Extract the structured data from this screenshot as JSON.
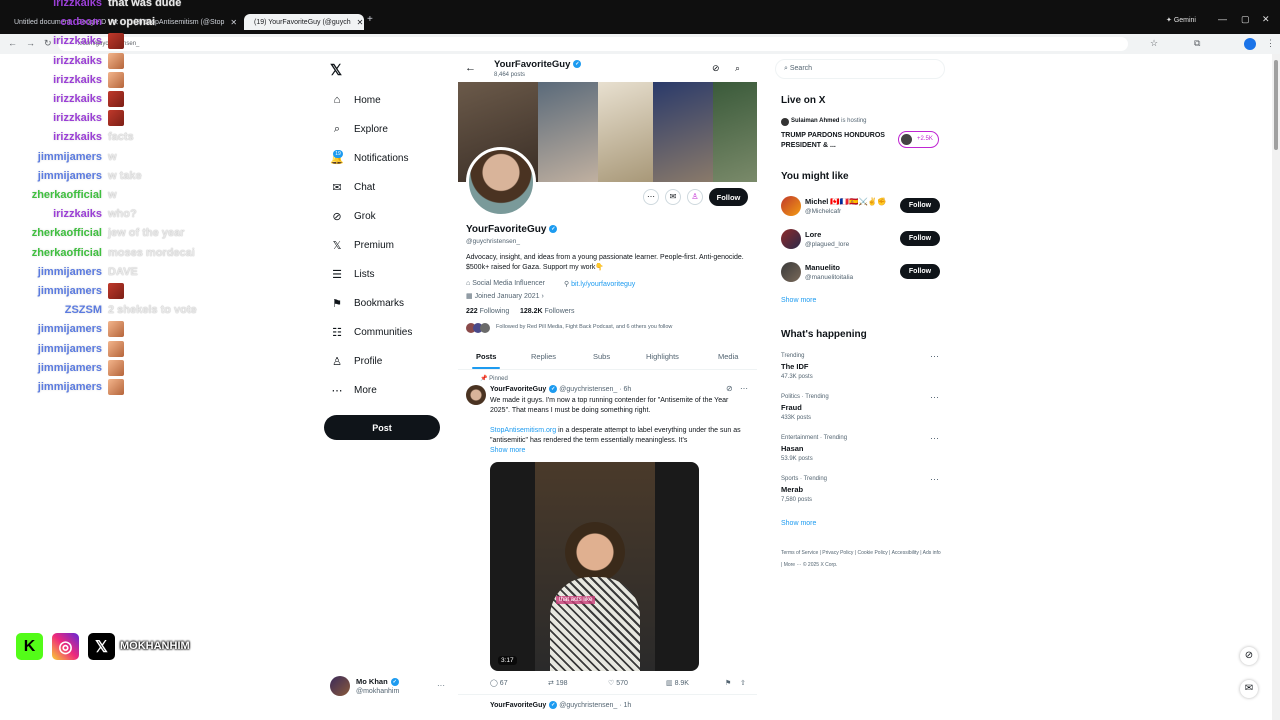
{
  "browser": {
    "tabs": [
      {
        "label": "Untitled document - Google D",
        "active": false
      },
      {
        "label": "(8) StopAntisemitism (@Stop",
        "active": false
      },
      {
        "label": "(19) YourFavoriteGuy (@guych",
        "active": true
      }
    ],
    "new_tab": "+",
    "gemini_label": "Gemini",
    "url": "x.com/guychristensen_"
  },
  "chat": [
    {
      "user": "irizzkaiks",
      "msg": "that was dude",
      "color": "#9b3fd6",
      "emote": ""
    },
    {
      "user": "cadeom",
      "msg": "w openai",
      "color": "#9b3fd6",
      "emote": ""
    },
    {
      "user": "irizzkaiks",
      "msg": "",
      "color": "#9b3fd6",
      "emote": "red"
    },
    {
      "user": "irizzkaiks",
      "msg": "",
      "color": "#9b3fd6",
      "emote": "face"
    },
    {
      "user": "irizzkaiks",
      "msg": "",
      "color": "#9b3fd6",
      "emote": "face"
    },
    {
      "user": "irizzkaiks",
      "msg": "",
      "color": "#9b3fd6",
      "emote": "red"
    },
    {
      "user": "irizzkaiks",
      "msg": "",
      "color": "#9b3fd6",
      "emote": "red"
    },
    {
      "user": "irizzkaiks",
      "msg": "facts",
      "color": "#9b3fd6",
      "emote": ""
    },
    {
      "user": "jimmijamers",
      "msg": "w",
      "color": "#5b7be0",
      "emote": ""
    },
    {
      "user": "jimmijamers",
      "msg": "w take",
      "color": "#5b7be0",
      "emote": ""
    },
    {
      "user": "zherkaofficial",
      "msg": "w",
      "color": "#3fbf3f",
      "emote": ""
    },
    {
      "user": "irizzkaiks",
      "msg": "who?",
      "color": "#9b3fd6",
      "emote": ""
    },
    {
      "user": "zherkaofficial",
      "msg": "jew of the year",
      "color": "#3fbf3f",
      "emote": ""
    },
    {
      "user": "zherkaofficial",
      "msg": "moses mordecai",
      "color": "#3fbf3f",
      "emote": ""
    },
    {
      "user": "jimmijamers",
      "msg": "DAVE",
      "color": "#5b7be0",
      "emote": ""
    },
    {
      "user": "jimmijamers",
      "msg": "",
      "color": "#5b7be0",
      "emote": "red"
    },
    {
      "user": "ZSZSM",
      "msg": "2 shekels to vote",
      "color": "#5b7be0",
      "emote": ""
    },
    {
      "user": "jimmijamers",
      "msg": "",
      "color": "#5b7be0",
      "emote": "face"
    },
    {
      "user": "jimmijamers",
      "msg": "",
      "color": "#5b7be0",
      "emote": "face"
    },
    {
      "user": "jimmijamers",
      "msg": "",
      "color": "#5b7be0",
      "emote": "face"
    },
    {
      "user": "jimmijamers",
      "msg": "",
      "color": "#5b7be0",
      "emote": "face"
    }
  ],
  "socials": {
    "kick": "K",
    "instagram": "◎",
    "x": "𝕏",
    "handle": "MOKHANHIM"
  },
  "nav": {
    "logo": "𝕏",
    "items": [
      {
        "label": "Home",
        "icon": "⌂"
      },
      {
        "label": "Explore",
        "icon": "⌕"
      },
      {
        "label": "Notifications",
        "icon": "🔔"
      },
      {
        "label": "Chat",
        "icon": "✉"
      },
      {
        "label": "Grok",
        "icon": "⊘"
      },
      {
        "label": "Premium",
        "icon": "𝕏"
      },
      {
        "label": "Lists",
        "icon": "☰"
      },
      {
        "label": "Bookmarks",
        "icon": "⚑"
      },
      {
        "label": "Communities",
        "icon": "☷"
      },
      {
        "label": "Profile",
        "icon": "♙"
      },
      {
        "label": "More",
        "icon": "⋯"
      }
    ],
    "notif_badge": "19",
    "post_label": "Post",
    "account": {
      "name": "Mo Khan",
      "handle": "@mokhanhim",
      "more": "···"
    }
  },
  "profile": {
    "header_name": "YourFavoriteGuy",
    "header_posts": "8,464 posts",
    "name": "YourFavoriteGuy",
    "handle": "@guychristensen_",
    "bio": "Advocacy, insight, and ideas from a young passionate learner. People-first. Anti-genocide. $500k+ raised for Gaza. Support my work👇",
    "category": "Social Media Influencer",
    "link": "bit.ly/yourfavoriteguy",
    "joined": "Joined January 2021",
    "following_count": "222",
    "following_label": "Following",
    "followers_count": "128.2K",
    "followers_label": "Followers",
    "followed_by": "Followed by Red Pill Media, Fight Back Podcast, and 6 others you follow",
    "follow_label": "Follow",
    "tabs": [
      "Posts",
      "Replies",
      "Subs",
      "Highlights",
      "Media"
    ],
    "pinned_label": "Pinned",
    "post": {
      "author": "YourFavoriteGuy",
      "handle_time": "@guychristensen_ · 6h",
      "text1": "We made it guys. I'm now a top running contender for \"Antisemite of the Year 2025\". That means I must be doing something right.",
      "link": "StopAntisemitism.org",
      "text2": " in a desperate attempt to label everything under the sun as \"antisemitic\" has rendered the term essentially meaningless. It's",
      "show_more": "Show more",
      "video_caption": "that acts like",
      "duration": "3:17",
      "replies": "67",
      "reposts": "198",
      "likes": "570",
      "views": "8.9K"
    },
    "next_post_author": "YourFavoriteGuy",
    "next_post_meta": "@guychristensen_ · 1h"
  },
  "right": {
    "search_placeholder": "Search",
    "live_title": "Live on X",
    "live_host": "Sulaiman Ahmed",
    "live_host_suffix": "is hosting",
    "live_text": "TRUMP PARDONS HONDUROS PRESIDENT & ...",
    "live_count": "+2.5K",
    "ymal_title": "You might like",
    "suggestions": [
      {
        "name": "Michel 🇨🇦🇫🇷🇪🇸⚔️✌️✊",
        "handle": "@Michelcafr"
      },
      {
        "name": "Lore",
        "handle": "@plagued_lore"
      },
      {
        "name": "Manuelito",
        "handle": "@manuelitoitalia"
      }
    ],
    "follow_label": "Follow",
    "show_more": "Show more",
    "happening_title": "What's happening",
    "trends": [
      {
        "category": "Trending",
        "name": "The IDF",
        "count": "47.3K posts"
      },
      {
        "category": "Politics · Trending",
        "name": "Fraud",
        "count": "433K posts"
      },
      {
        "category": "Entertainment · Trending",
        "name": "Hasan",
        "count": "53.9K posts"
      },
      {
        "category": "Sports · Trending",
        "name": "Merab",
        "count": "7,580 posts"
      }
    ],
    "show_more2": "Show more",
    "footer": "Terms of Service | Privacy Policy | Cookie Policy | Accessibility | Ads info | More ··· © 2025 X Corp."
  }
}
